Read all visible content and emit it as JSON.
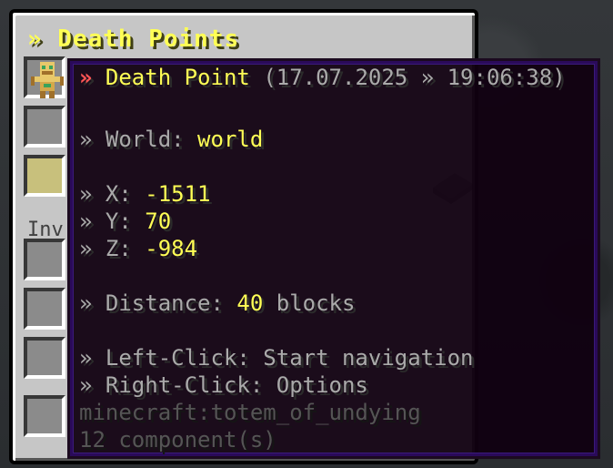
{
  "gui": {
    "title": "» Death Points",
    "inventory_label": "Inv"
  },
  "tooltip": {
    "header_arrow": "»",
    "header_name": "Death Point",
    "header_timestamp": "(17.07.2025 » 19:06:38)",
    "world_prefix": "» World: ",
    "world_value": "world",
    "x_prefix": "» X: ",
    "x_value": "-1511",
    "y_prefix": "» Y: ",
    "y_value": "70",
    "z_prefix": "» Z: ",
    "z_value": "-984",
    "distance_prefix": "» Distance: ",
    "distance_value": "40",
    "distance_suffix": " blocks",
    "left_click": "» Left-Click: Start navigation",
    "right_click": "» Right-Click: Options",
    "item_id": "minecraft:totem_of_undying",
    "components": "12 component(s)"
  },
  "items": {
    "slot_item": "totem-of-undying-icon",
    "background_item": "book-icon"
  },
  "colors": {
    "yellow": "#ffff55",
    "red": "#ff5555",
    "gray": "#aaaaaa",
    "dark_gray": "#555555"
  }
}
